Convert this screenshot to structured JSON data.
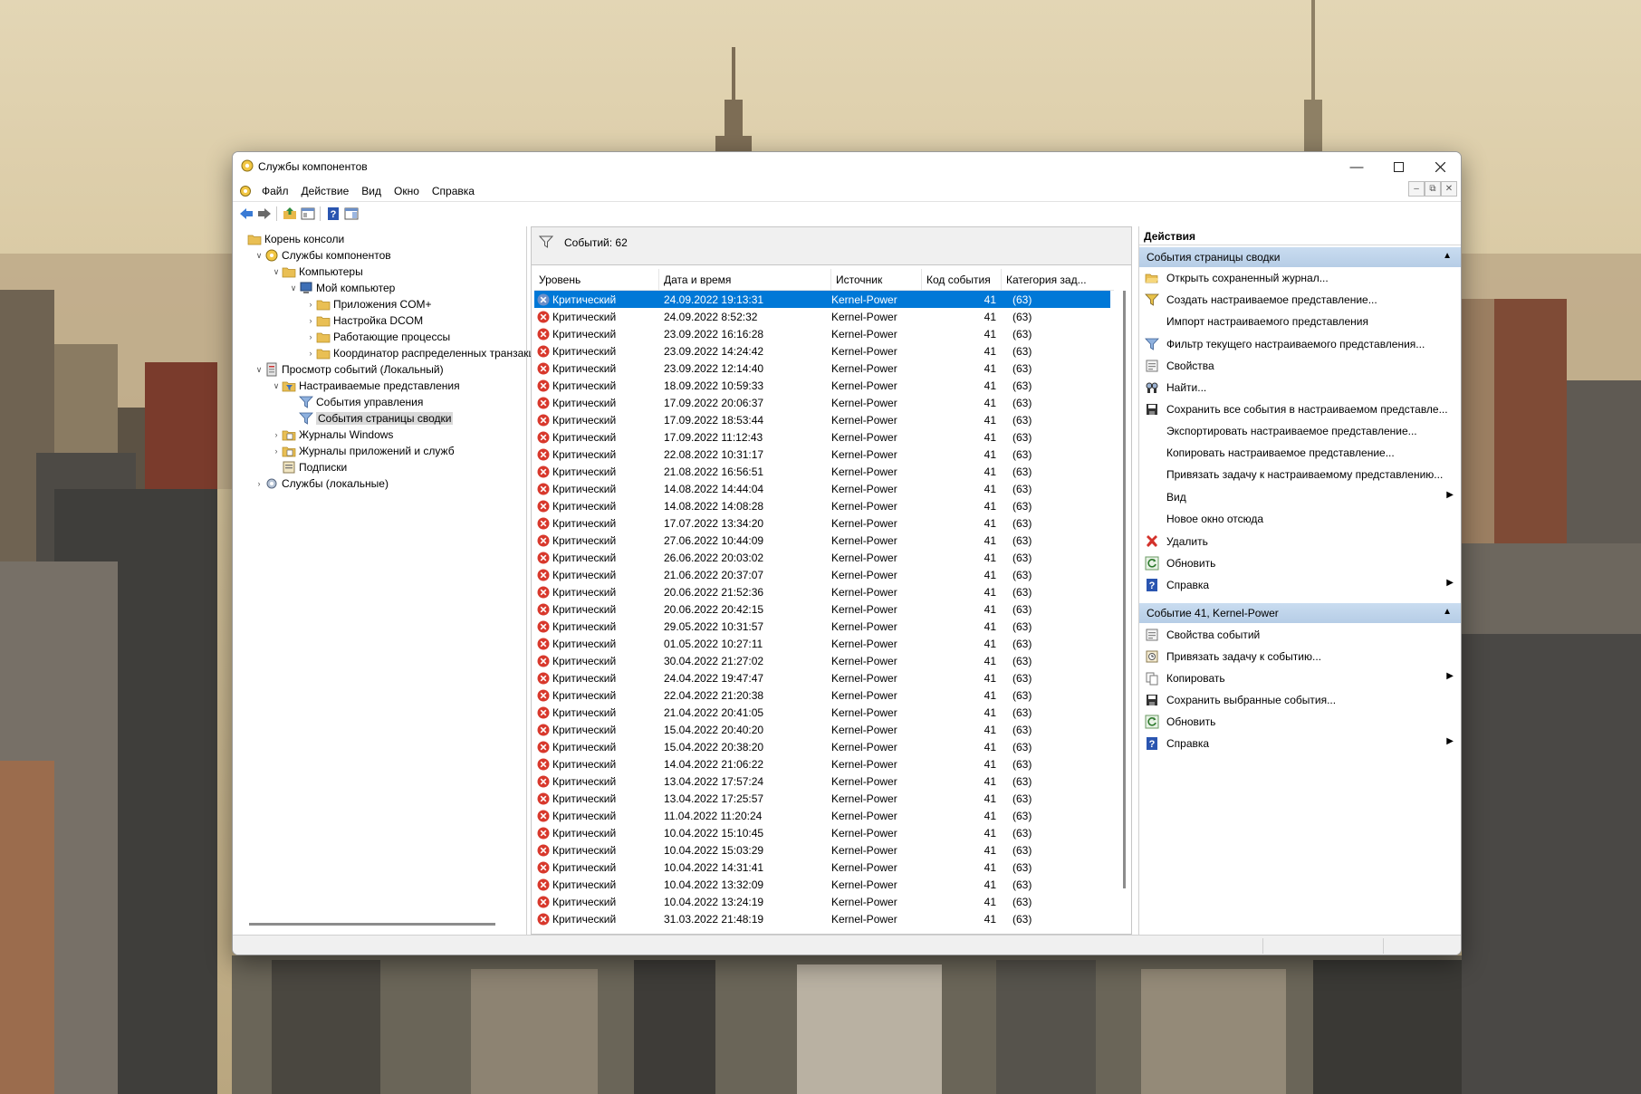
{
  "window": {
    "title": "Службы компонентов"
  },
  "menu": [
    "Файл",
    "Действие",
    "Вид",
    "Окно",
    "Справка"
  ],
  "tree": [
    {
      "label": "Корень консоли",
      "icon": "folder-icon",
      "indent": 0,
      "expander": "",
      "selected": false
    },
    {
      "label": "Службы компонентов",
      "icon": "component-services-icon",
      "indent": 1,
      "expander": "v",
      "selected": false
    },
    {
      "label": "Компьютеры",
      "icon": "folder-icon",
      "indent": 2,
      "expander": "v",
      "selected": false
    },
    {
      "label": "Мой компьютер",
      "icon": "computer-icon",
      "indent": 3,
      "expander": "v",
      "selected": false
    },
    {
      "label": "Приложения COM+",
      "icon": "folder-icon",
      "indent": 4,
      "expander": ">",
      "selected": false
    },
    {
      "label": "Настройка DCOM",
      "icon": "folder-icon",
      "indent": 4,
      "expander": ">",
      "selected": false
    },
    {
      "label": "Работающие процессы",
      "icon": "folder-icon",
      "indent": 4,
      "expander": ">",
      "selected": false
    },
    {
      "label": "Координатор распределенных транзакц",
      "icon": "folder-icon",
      "indent": 4,
      "expander": ">",
      "selected": false
    },
    {
      "label": "Просмотр событий (Локальный)",
      "icon": "event-viewer-icon",
      "indent": 1,
      "expander": "v",
      "selected": false
    },
    {
      "label": "Настраиваемые представления",
      "icon": "folder-filter-icon",
      "indent": 2,
      "expander": "v",
      "selected": false
    },
    {
      "label": "События управления",
      "icon": "filter-icon",
      "indent": 3,
      "expander": "",
      "selected": false
    },
    {
      "label": "События страницы сводки",
      "icon": "filter-icon",
      "indent": 3,
      "expander": "",
      "selected": true
    },
    {
      "label": "Журналы Windows",
      "icon": "log-folder-icon",
      "indent": 2,
      "expander": ">",
      "selected": false
    },
    {
      "label": "Журналы приложений и служб",
      "icon": "log-folder-icon",
      "indent": 2,
      "expander": ">",
      "selected": false
    },
    {
      "label": "Подписки",
      "icon": "subscriptions-icon",
      "indent": 2,
      "expander": "",
      "selected": false
    },
    {
      "label": "Службы (локальные)",
      "icon": "gear-icon",
      "indent": 1,
      "expander": ">",
      "selected": false
    }
  ],
  "center": {
    "events_count": "Событий: 62",
    "columns": [
      "Уровень",
      "Дата и время",
      "Источник",
      "Код события",
      "Категория зад..."
    ],
    "rows": [
      {
        "level": "Критический",
        "date": "24.09.2022 19:13:31",
        "source": "Kernel-Power",
        "code": "41",
        "category": "(63)"
      },
      {
        "level": "Критический",
        "date": "24.09.2022 8:52:32",
        "source": "Kernel-Power",
        "code": "41",
        "category": "(63)"
      },
      {
        "level": "Критический",
        "date": "23.09.2022 16:16:28",
        "source": "Kernel-Power",
        "code": "41",
        "category": "(63)"
      },
      {
        "level": "Критический",
        "date": "23.09.2022 14:24:42",
        "source": "Kernel-Power",
        "code": "41",
        "category": "(63)"
      },
      {
        "level": "Критический",
        "date": "23.09.2022 12:14:40",
        "source": "Kernel-Power",
        "code": "41",
        "category": "(63)"
      },
      {
        "level": "Критический",
        "date": "18.09.2022 10:59:33",
        "source": "Kernel-Power",
        "code": "41",
        "category": "(63)"
      },
      {
        "level": "Критический",
        "date": "17.09.2022 20:06:37",
        "source": "Kernel-Power",
        "code": "41",
        "category": "(63)"
      },
      {
        "level": "Критический",
        "date": "17.09.2022 18:53:44",
        "source": "Kernel-Power",
        "code": "41",
        "category": "(63)"
      },
      {
        "level": "Критический",
        "date": "17.09.2022 11:12:43",
        "source": "Kernel-Power",
        "code": "41",
        "category": "(63)"
      },
      {
        "level": "Критический",
        "date": "22.08.2022 10:31:17",
        "source": "Kernel-Power",
        "code": "41",
        "category": "(63)"
      },
      {
        "level": "Критический",
        "date": "21.08.2022 16:56:51",
        "source": "Kernel-Power",
        "code": "41",
        "category": "(63)"
      },
      {
        "level": "Критический",
        "date": "14.08.2022 14:44:04",
        "source": "Kernel-Power",
        "code": "41",
        "category": "(63)"
      },
      {
        "level": "Критический",
        "date": "14.08.2022 14:08:28",
        "source": "Kernel-Power",
        "code": "41",
        "category": "(63)"
      },
      {
        "level": "Критический",
        "date": "17.07.2022 13:34:20",
        "source": "Kernel-Power",
        "code": "41",
        "category": "(63)"
      },
      {
        "level": "Критический",
        "date": "27.06.2022 10:44:09",
        "source": "Kernel-Power",
        "code": "41",
        "category": "(63)"
      },
      {
        "level": "Критический",
        "date": "26.06.2022 20:03:02",
        "source": "Kernel-Power",
        "code": "41",
        "category": "(63)"
      },
      {
        "level": "Критический",
        "date": "21.06.2022 20:37:07",
        "source": "Kernel-Power",
        "code": "41",
        "category": "(63)"
      },
      {
        "level": "Критический",
        "date": "20.06.2022 21:52:36",
        "source": "Kernel-Power",
        "code": "41",
        "category": "(63)"
      },
      {
        "level": "Критический",
        "date": "20.06.2022 20:42:15",
        "source": "Kernel-Power",
        "code": "41",
        "category": "(63)"
      },
      {
        "level": "Критический",
        "date": "29.05.2022 10:31:57",
        "source": "Kernel-Power",
        "code": "41",
        "category": "(63)"
      },
      {
        "level": "Критический",
        "date": "01.05.2022 10:27:11",
        "source": "Kernel-Power",
        "code": "41",
        "category": "(63)"
      },
      {
        "level": "Критический",
        "date": "30.04.2022 21:27:02",
        "source": "Kernel-Power",
        "code": "41",
        "category": "(63)"
      },
      {
        "level": "Критический",
        "date": "24.04.2022 19:47:47",
        "source": "Kernel-Power",
        "code": "41",
        "category": "(63)"
      },
      {
        "level": "Критический",
        "date": "22.04.2022 21:20:38",
        "source": "Kernel-Power",
        "code": "41",
        "category": "(63)"
      },
      {
        "level": "Критический",
        "date": "21.04.2022 20:41:05",
        "source": "Kernel-Power",
        "code": "41",
        "category": "(63)"
      },
      {
        "level": "Критический",
        "date": "15.04.2022 20:40:20",
        "source": "Kernel-Power",
        "code": "41",
        "category": "(63)"
      },
      {
        "level": "Критический",
        "date": "15.04.2022 20:38:20",
        "source": "Kernel-Power",
        "code": "41",
        "category": "(63)"
      },
      {
        "level": "Критический",
        "date": "14.04.2022 21:06:22",
        "source": "Kernel-Power",
        "code": "41",
        "category": "(63)"
      },
      {
        "level": "Критический",
        "date": "13.04.2022 17:57:24",
        "source": "Kernel-Power",
        "code": "41",
        "category": "(63)"
      },
      {
        "level": "Критический",
        "date": "13.04.2022 17:25:57",
        "source": "Kernel-Power",
        "code": "41",
        "category": "(63)"
      },
      {
        "level": "Критический",
        "date": "11.04.2022 11:20:24",
        "source": "Kernel-Power",
        "code": "41",
        "category": "(63)"
      },
      {
        "level": "Критический",
        "date": "10.04.2022 15:10:45",
        "source": "Kernel-Power",
        "code": "41",
        "category": "(63)"
      },
      {
        "level": "Критический",
        "date": "10.04.2022 15:03:29",
        "source": "Kernel-Power",
        "code": "41",
        "category": "(63)"
      },
      {
        "level": "Критический",
        "date": "10.04.2022 14:31:41",
        "source": "Kernel-Power",
        "code": "41",
        "category": "(63)"
      },
      {
        "level": "Критический",
        "date": "10.04.2022 13:32:09",
        "source": "Kernel-Power",
        "code": "41",
        "category": "(63)"
      },
      {
        "level": "Критический",
        "date": "10.04.2022 13:24:19",
        "source": "Kernel-Power",
        "code": "41",
        "category": "(63)"
      },
      {
        "level": "Критический",
        "date": "31.03.2022 21:48:19",
        "source": "Kernel-Power",
        "code": "41",
        "category": "(63)"
      }
    ]
  },
  "actions": {
    "title": "Действия",
    "section1": {
      "title": "События страницы сводки",
      "items": [
        {
          "label": "Открыть сохраненный журнал...",
          "icon": "open-folder-icon",
          "submenu": false
        },
        {
          "label": "Создать настраиваемое представление...",
          "icon": "create-filter-icon",
          "submenu": false
        },
        {
          "label": "Импорт настраиваемого представления",
          "icon": "",
          "submenu": false
        },
        {
          "label": "Фильтр текущего настраиваемого представления...",
          "icon": "filter-icon",
          "submenu": false
        },
        {
          "label": "Свойства",
          "icon": "properties-icon",
          "submenu": false
        },
        {
          "label": "Найти...",
          "icon": "find-icon",
          "submenu": false
        },
        {
          "label": "Сохранить все события в настраиваемом представле...",
          "icon": "save-icon",
          "submenu": false
        },
        {
          "label": "Экспортировать настраиваемое представление...",
          "icon": "",
          "submenu": false
        },
        {
          "label": "Копировать настраиваемое представление...",
          "icon": "",
          "submenu": false
        },
        {
          "label": "Привязать задачу к настраиваемому представлению...",
          "icon": "",
          "submenu": false
        },
        {
          "label": "Вид",
          "icon": "",
          "submenu": true
        },
        {
          "label": "Новое окно отсюда",
          "icon": "",
          "submenu": false
        },
        {
          "label": "Удалить",
          "icon": "delete-icon",
          "submenu": false
        },
        {
          "label": "Обновить",
          "icon": "refresh-icon",
          "submenu": false
        },
        {
          "label": "Справка",
          "icon": "help-icon",
          "submenu": true
        }
      ]
    },
    "section2": {
      "title": "Событие 41, Kernel-Power",
      "items": [
        {
          "label": "Свойства событий",
          "icon": "properties-icon",
          "submenu": false
        },
        {
          "label": "Привязать задачу к событию...",
          "icon": "task-icon",
          "submenu": false
        },
        {
          "label": "Копировать",
          "icon": "copy-icon",
          "submenu": true
        },
        {
          "label": "Сохранить выбранные события...",
          "icon": "save-icon",
          "submenu": false
        },
        {
          "label": "Обновить",
          "icon": "refresh-icon",
          "submenu": false
        },
        {
          "label": "Справка",
          "icon": "help-icon",
          "submenu": true
        }
      ]
    }
  },
  "colors": {
    "selection": "#0078d7",
    "section_header": "#c4d8ee",
    "error": "#d8382c"
  }
}
